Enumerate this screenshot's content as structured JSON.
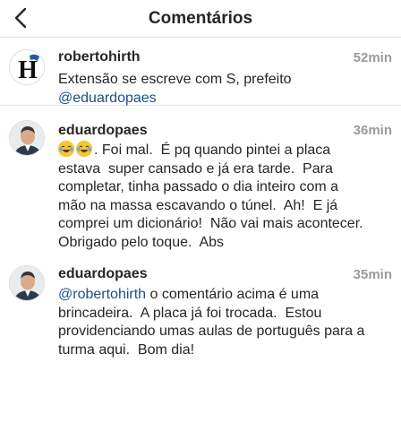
{
  "header": {
    "title": "Comentários",
    "back_icon": "chevron-left-icon"
  },
  "comments": [
    {
      "username": "robertohirth",
      "time": "52min",
      "text_lines": [
        "Extensão se escreve com S, prefeito"
      ],
      "mention": "@eduardopaes",
      "avatar": "logo-H-avatar",
      "avatar_letter": "H"
    },
    {
      "username": "eduardopaes",
      "time": "36min",
      "emoji": "tears-of-joy-emoji",
      "text_first": ". Foi mal.  É pq quando pintei a placa",
      "text_rest": "estava  super cansado e já era tarde.  Para\ncompletar, tinha passado o dia inteiro com a\nmão na massa escavando o túnel.  Ah!  E já\ncomprei um dicionário!  Não vai mais acontecer.\nObrigado pelo toque.  Abs",
      "avatar": "person-photo-avatar"
    },
    {
      "username": "eduardopaes",
      "time": "35min",
      "mention": "@robertohirth",
      "text_first": " o comentário acima é uma",
      "text_rest": "brincadeira.  A placa já foi trocada.  Estou\nprovidenciando umas aulas de português para a\nturma aqui.  Bom dia!",
      "avatar": "person-photo-avatar"
    }
  ],
  "colors": {
    "mention": "#1e4e86",
    "time": "#9a9a9a",
    "divider": "#dbdbdb"
  }
}
